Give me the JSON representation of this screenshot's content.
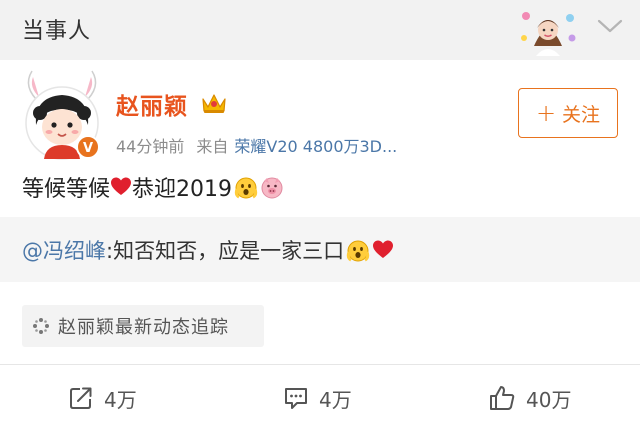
{
  "header": {
    "title": "当事人",
    "avatar_icon": "profile-avatar-icon",
    "chevron_icon": "chevron-down-icon"
  },
  "post": {
    "username": "赵丽颖",
    "badge_icon": "crown-icon",
    "avatar_icon": "cartoon-avatar-icon",
    "time": "44分钟前",
    "from_label": "来自",
    "device": "荣耀V20 4800万3D...",
    "follow_label": "关注",
    "text_part1": "等候等候",
    "text_part2": "恭迎2019",
    "text_icons": [
      "heart-icon",
      "fearful-face-icon",
      "pig-face-icon"
    ]
  },
  "repost": {
    "mention": "@冯绍峰",
    "text": " :知否知否，应是一家三口",
    "icons": [
      "fearful-face-icon",
      "heart-icon"
    ]
  },
  "topic": {
    "label": "赵丽颖最新动态追踪",
    "icon": "sparkle-icon"
  },
  "actions": {
    "repost_count": "4万",
    "comment_count": "4万",
    "like_count": "40万"
  },
  "colors": {
    "username": "#e8541e",
    "accent": "#e8731e",
    "link": "#4b77a8",
    "heart": "#e0202e"
  }
}
